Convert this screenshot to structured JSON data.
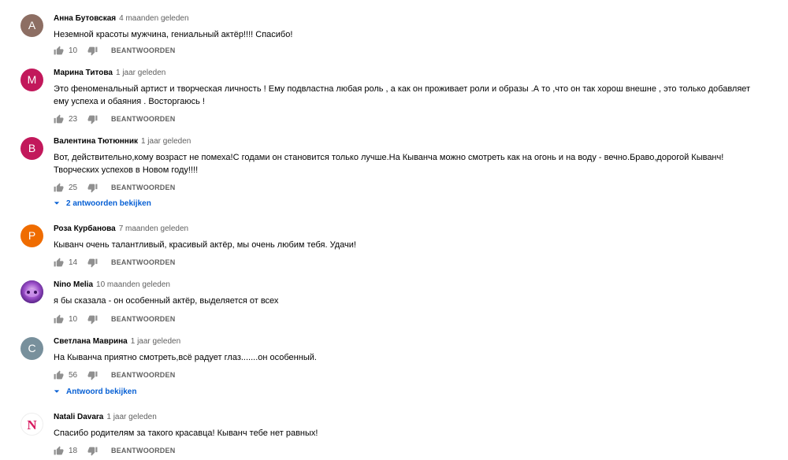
{
  "actions": {
    "reply_label": "BEANTWOORDEN"
  },
  "comments": [
    {
      "avatar_letter": "A",
      "avatar_color": "#8d6e63",
      "author": "Анна Бутовская",
      "time": "4 maanden geleden",
      "text": "Неземной красоты мужчина, гениальный актёр!!!! Спасибо!",
      "likes": "10",
      "replies_label": ""
    },
    {
      "avatar_letter": "M",
      "avatar_color": "#c2185b",
      "author": "Марина Титова",
      "time": "1 jaar geleden",
      "text": "Это феноменальный артист и творческая личность ! Ему подвластна любая роль , а как он проживает роли  и образы .А то ,что он так хорош внешне , это только  добавляет  ему успеха и обаяния . Восторгаюсь !",
      "likes": "23",
      "replies_label": ""
    },
    {
      "avatar_letter": "B",
      "avatar_color": "#c2185b",
      "author": "Валентина Тютюнник",
      "time": "1 jaar geleden",
      "text": "Вот, действительно,кому возраст  не помеха!С годами он становится только лучше.На Кыванча можно смотреть как на огонь  и на воду - вечно.Браво,дорогой Кыванч!Творческих успехов в Новом году!!!!",
      "likes": "25",
      "replies_label": "2 antwoorden bekijken"
    },
    {
      "avatar_letter": "P",
      "avatar_color": "#ef6c00",
      "author": "Роза Курбанова",
      "time": "7 maanden geleden",
      "text": "Кыванч очень талантливый, красивый актёр, мы очень любим тебя. Удачи!",
      "likes": "14",
      "replies_label": ""
    },
    {
      "avatar_letter": "",
      "avatar_color": "#7b3fa6",
      "author": "Nino Melia",
      "time": "10 maanden geleden",
      "text": "я бы сказала - он особенный актёр, выделяется от всех",
      "likes": "10",
      "replies_label": ""
    },
    {
      "avatar_letter": "C",
      "avatar_color": "#78909c",
      "author": "Светлана Маврина",
      "time": "1 jaar geleden",
      "text": "На Кыванча приятно смотреть,всё радует глаз.......он особенный.",
      "likes": "56",
      "replies_label": "Antwoord bekijken"
    },
    {
      "avatar_letter": "N",
      "avatar_color": "#ffffff",
      "author": "Natali Davara",
      "time": "1 jaar geleden",
      "text": "Спасибо родителям за такого красавца! Кыванч тебе нет равных!",
      "likes": "18",
      "replies_label": ""
    }
  ]
}
